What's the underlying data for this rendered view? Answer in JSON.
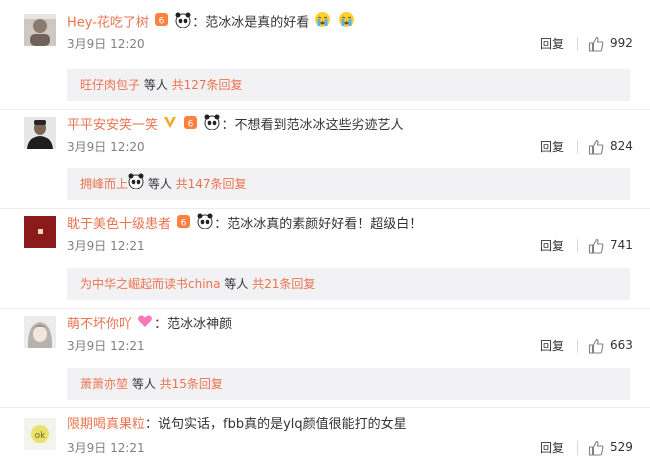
{
  "comments": [
    {
      "username": "Hey-花吃了树",
      "text": "：范冰冰是真的好看",
      "time": "3月9日 12:20",
      "reply_label": "回复",
      "likes": "992",
      "sub": {
        "user": "旺仔肉包子",
        "mid": " 等人 ",
        "count": "共127条回复"
      }
    },
    {
      "username": "平平安安笑一笑",
      "text": "：不想看到范冰冰这些劣迹艺人",
      "time": "3月9日 12:20",
      "reply_label": "回复",
      "likes": "824",
      "sub": {
        "user": "拥峰而上",
        "mid": " 等人 ",
        "count": "共147条回复"
      }
    },
    {
      "username": "耽于美色十级患者",
      "text": "：范冰冰真的素颜好好看！超级白！",
      "time": "3月9日 12:21",
      "reply_label": "回复",
      "likes": "741",
      "sub": {
        "user": "为中华之崛起而读书china",
        "mid": " 等人 ",
        "count": "共21条回复"
      }
    },
    {
      "username": "萌不坏你吖",
      "text": "：范冰冰神颜",
      "time": "3月9日 12:21",
      "reply_label": "回复",
      "likes": "663",
      "sub": {
        "user": "萧萧亦堃",
        "mid": " 等人 ",
        "count": "共15条回复"
      }
    },
    {
      "username": "限期喝真果粒",
      "text": "：说句实话，fbb真的是ylq颜值很能打的女星",
      "time": "3月9日 12:21",
      "reply_label": "回复",
      "likes": "529"
    }
  ],
  "colors": {
    "link": "#eb7350",
    "meta": "#808080",
    "subbox": "#f2f2f5"
  }
}
